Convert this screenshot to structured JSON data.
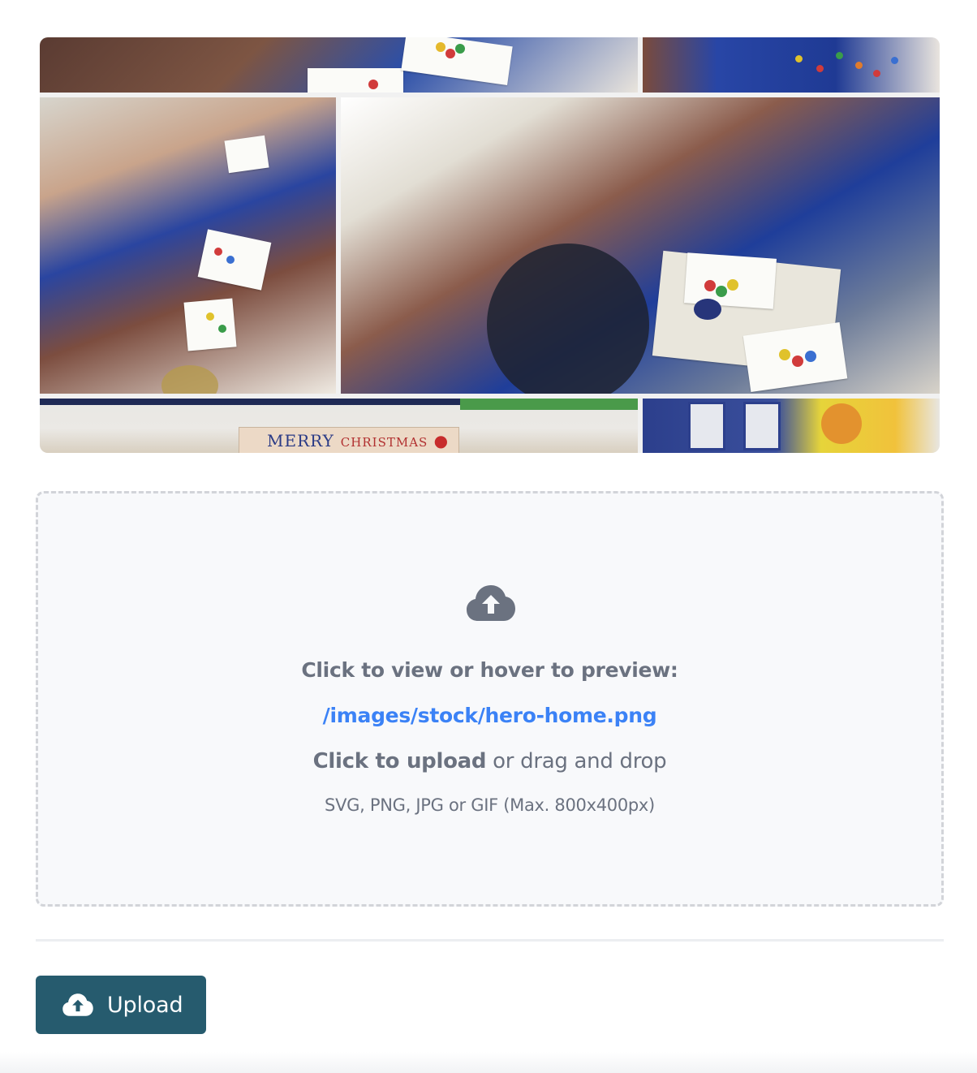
{
  "hero": {
    "banner_word_1": "MERRY",
    "banner_word_2": "CHRISTMAS"
  },
  "dropzone": {
    "preview_label": "Click to view or hover to preview:",
    "current_path": "/images/stock/hero-home.png",
    "upload_strong": "Click to upload",
    "upload_rest": " or drag and drop",
    "formats_hint": "SVG, PNG, JPG or GIF (Max. 800x400px)",
    "icon": "cloud-upload-icon"
  },
  "actions": {
    "upload_label": "Upload",
    "upload_icon": "cloud-upload-icon"
  },
  "colors": {
    "button_bg": "#265b6e",
    "link": "#3b82f6",
    "muted_text": "#6b7280",
    "dropzone_bg": "#f8f9fb",
    "dropzone_border": "#d2d4d9"
  }
}
